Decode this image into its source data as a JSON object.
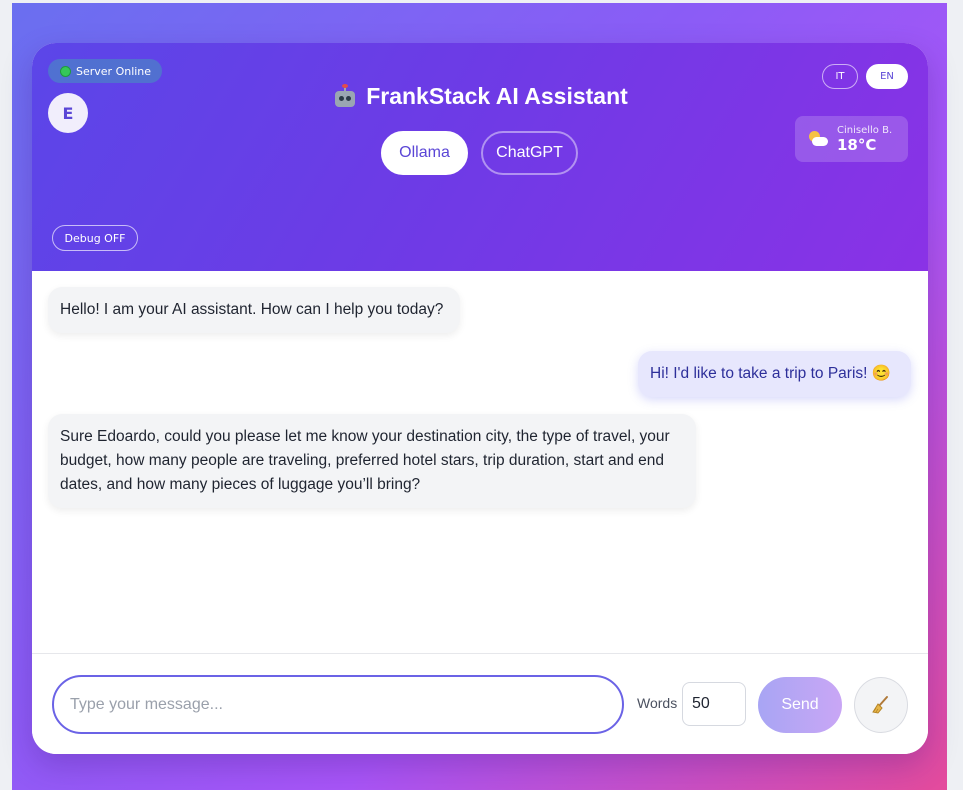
{
  "header": {
    "status": "Server Online",
    "avatar_initial": "E",
    "title": "FrankStack AI Assistant",
    "model_tabs": [
      {
        "label": "Ollama",
        "active": true
      },
      {
        "label": "ChatGPT",
        "active": false
      }
    ],
    "languages": [
      "IT",
      "EN"
    ],
    "active_language": "EN",
    "weather": {
      "city": "Cinisello B.",
      "temp": "18°C",
      "icon": "partly-cloudy-icon"
    },
    "debug_label": "Debug OFF"
  },
  "messages": [
    {
      "role": "bot",
      "text": "Hello! I am your AI assistant. How can I help you today?"
    },
    {
      "role": "user",
      "text": "Hi! I'd like to take a trip to Paris! 😊"
    },
    {
      "role": "bot",
      "text": "Sure Edoardo, could you please let me know your destination city, the type of travel, your budget, how many people are traveling, preferred hotel stars, trip duration, start and end dates, and how many pieces of luggage you’ll bring?"
    }
  ],
  "composer": {
    "placeholder": "Type your message...",
    "words_label": "Words",
    "words_value": "50",
    "send_label": "Send",
    "clear_icon": "broom-icon"
  },
  "colors": {
    "accent": "#5b46d6",
    "header_gradient_start": "#5b46e8",
    "header_gradient_end": "#8a32e6",
    "status_online": "#35c759",
    "user_bubble": "#e7e7fd",
    "bot_bubble": "#f3f4f6"
  }
}
